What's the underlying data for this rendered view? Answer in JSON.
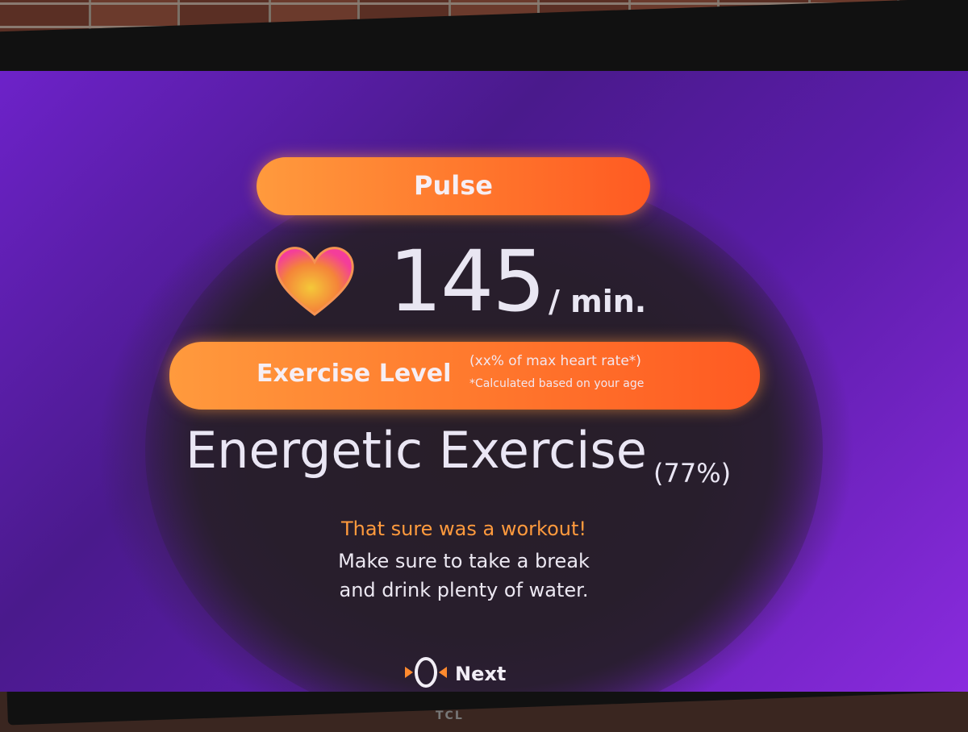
{
  "pulse": {
    "title": "Pulse",
    "value": "145",
    "unit": "/ min."
  },
  "exercise": {
    "title": "Exercise Level",
    "note_line1": "(xx% of max heart rate*)",
    "note_line2": "*Calculated based on your age",
    "level": "Energetic Exercise",
    "percent": "(77%)"
  },
  "message": {
    "line1": "That sure was a workout!",
    "line2": "Make sure to take a break",
    "line3": "and drink plenty of water."
  },
  "next": {
    "label": "Next"
  },
  "tv": {
    "brand": "TCL"
  },
  "colors": {
    "accent": "#ff7a2e",
    "highlight_text": "#ff9a3d",
    "screen_purple": "#6d22c9"
  }
}
